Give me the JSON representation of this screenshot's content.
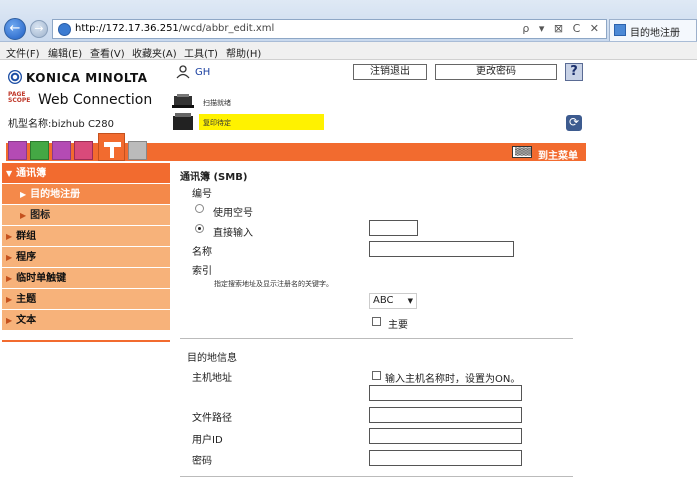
{
  "browser": {
    "url_host": "http://172.17.36.251",
    "url_path": "/wcd/abbr_edit.xml",
    "tools": "ρ ▾ ⊠ C ✕",
    "tab_title": "目的地注册",
    "menu": [
      "文件(F)",
      "编辑(E)",
      "查看(V)",
      "收藏夹(A)",
      "工具(T)",
      "帮助(H)"
    ]
  },
  "header": {
    "brand": "KONICA MINOLTA",
    "pagescope": "PAGE SCOPE",
    "product": "Web Connection",
    "model": "机型名称:bizhub C280",
    "user": "GH",
    "logout_label": "注销退出",
    "change_password_label": "更改密码",
    "help_label": "?",
    "status_printer": "扫描就绪",
    "status_scanner": "复印待定"
  },
  "tabs": {
    "main_menu_icon_text": "▒▒▒",
    "main_menu_label": "到主菜单"
  },
  "sidebar": {
    "items": [
      {
        "label": "通讯簿",
        "level": 0,
        "active": true
      },
      {
        "label": "目的地注册",
        "level": 1,
        "active": true
      },
      {
        "label": "图标",
        "level": 1,
        "active": false
      },
      {
        "label": "群组",
        "level": 0,
        "active": false
      },
      {
        "label": "程序",
        "level": 0,
        "active": false
      },
      {
        "label": "临时单触键",
        "level": 0,
        "active": false
      },
      {
        "label": "主题",
        "level": 0,
        "active": false
      },
      {
        "label": "文本",
        "level": 0,
        "active": false
      }
    ]
  },
  "form": {
    "title": "通讯簿 (SMB)",
    "number_label": "编号",
    "radio_empty_label": "使用空号",
    "radio_direct_label": "直接输入",
    "number_value": "",
    "name_label": "名称",
    "name_value": "",
    "index_label": "索引",
    "index_hint": "指定搜索地址及显示注册名的关键字。",
    "index_value": "ABC",
    "main_label": "主要",
    "dest_info_label": "目的地信息",
    "host_label": "主机地址",
    "host_checkbox_label": "输入主机名称时，设置为ON。",
    "host_value": "",
    "filepath_label": "文件路径",
    "filepath_value": "",
    "userid_label": "用户ID",
    "userid_value": "",
    "password_label": "密码",
    "password_value": ""
  }
}
